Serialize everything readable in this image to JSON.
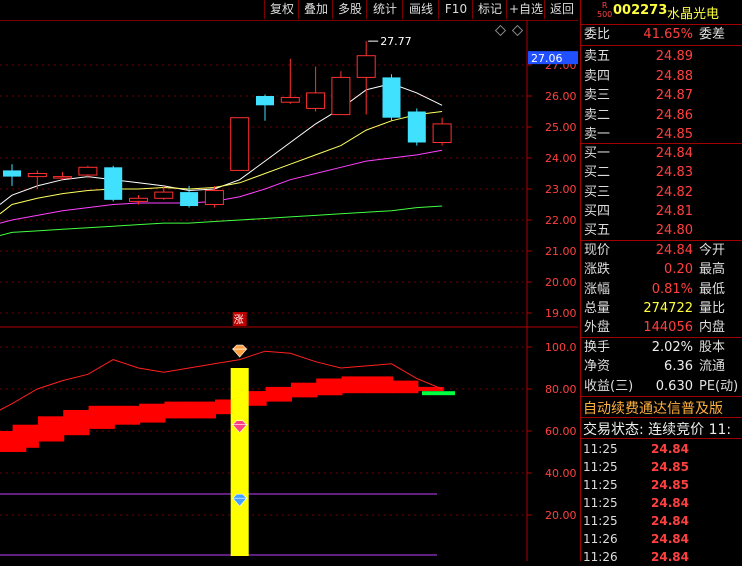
{
  "toolbar": {
    "buttons": [
      "复权",
      "叠加",
      "多股",
      "统计",
      "画线",
      "F10",
      "标记",
      "+自选",
      "返回"
    ]
  },
  "stock": {
    "market_badge_top": "R",
    "market_badge_bottom": "500",
    "code": "002273",
    "name": "水晶光电"
  },
  "order_ratio": {
    "label": "委比",
    "value": "41.65%",
    "right_label": "委差"
  },
  "sells": [
    {
      "label": "卖五",
      "price": "24.89"
    },
    {
      "label": "卖四",
      "price": "24.88"
    },
    {
      "label": "卖三",
      "price": "24.87"
    },
    {
      "label": "卖二",
      "price": "24.86"
    },
    {
      "label": "卖一",
      "price": "24.85"
    }
  ],
  "buys": [
    {
      "label": "买一",
      "price": "24.84"
    },
    {
      "label": "买二",
      "price": "24.83"
    },
    {
      "label": "买三",
      "price": "24.82"
    },
    {
      "label": "买四",
      "price": "24.81"
    },
    {
      "label": "买五",
      "price": "24.80"
    }
  ],
  "quote": [
    {
      "label": "现价",
      "value": "24.84",
      "right": "今开"
    },
    {
      "label": "涨跌",
      "value": "0.20",
      "right": "最高"
    },
    {
      "label": "涨幅",
      "value": "0.81%",
      "right": "最低"
    },
    {
      "label": "总量",
      "value": "274722",
      "right": "量比"
    },
    {
      "label": "外盘",
      "value": "144056",
      "right": "内盘"
    }
  ],
  "stats": [
    {
      "label": "换手",
      "value": "2.02%",
      "right": "股本"
    },
    {
      "label": "净资",
      "value": "6.36",
      "right": "流通"
    },
    {
      "label": "收益(三)",
      "value": "0.630",
      "right": "PE(动)"
    }
  ],
  "banner": "自动续费通达信普及版",
  "trade_status": "交易状态: 连续竞价 11:",
  "ticks": [
    {
      "time": "11:25",
      "price": "24.84"
    },
    {
      "time": "11:25",
      "price": "24.85"
    },
    {
      "time": "11:25",
      "price": "24.85"
    },
    {
      "time": "11:25",
      "price": "24.84"
    },
    {
      "time": "11:25",
      "price": "24.84"
    },
    {
      "time": "11:26",
      "price": "24.84"
    },
    {
      "time": "11:26",
      "price": "24.84"
    }
  ],
  "chart_data": [
    {
      "type": "candlestick",
      "title": "",
      "y_ticks": [
        "27.00",
        "26.00",
        "25.00",
        "24.00",
        "23.00",
        "22.00",
        "21.00",
        "20.00",
        "19.00"
      ],
      "ylim": [
        18.7,
        27.9
      ],
      "current_price_label": "27.06",
      "high_annotation": "27.77",
      "limit_up_marker": "涨",
      "candles": [
        {
          "o": 23.6,
          "c": 23.4,
          "h": 23.8,
          "l": 23.1
        },
        {
          "o": 23.4,
          "c": 23.5,
          "h": 23.6,
          "l": 23.0
        },
        {
          "o": 23.4,
          "c": 23.4,
          "h": 23.55,
          "l": 23.3
        },
        {
          "o": 23.45,
          "c": 23.7,
          "h": 23.75,
          "l": 23.35
        },
        {
          "o": 23.7,
          "c": 22.65,
          "h": 23.75,
          "l": 22.6
        },
        {
          "o": 22.6,
          "c": 22.7,
          "h": 22.8,
          "l": 22.5
        },
        {
          "o": 22.7,
          "c": 22.9,
          "h": 23.1,
          "l": 22.65
        },
        {
          "o": 22.9,
          "c": 22.45,
          "h": 23.1,
          "l": 22.4
        },
        {
          "o": 22.5,
          "c": 22.95,
          "h": 23.1,
          "l": 22.4
        },
        {
          "o": 23.6,
          "c": 25.3,
          "h": 25.3,
          "l": 23.6
        },
        {
          "o": 26.0,
          "c": 25.7,
          "h": 26.05,
          "l": 25.2
        },
        {
          "o": 25.8,
          "c": 25.95,
          "h": 27.2,
          "l": 25.75
        },
        {
          "o": 25.6,
          "c": 26.1,
          "h": 26.95,
          "l": 25.5
        },
        {
          "o": 25.4,
          "c": 26.6,
          "h": 26.8,
          "l": 25.4
        },
        {
          "o": 26.6,
          "c": 27.3,
          "h": 27.77,
          "l": 25.4
        },
        {
          "o": 26.6,
          "c": 25.3,
          "h": 26.7,
          "l": 25.2
        },
        {
          "o": 25.5,
          "c": 24.5,
          "h": 25.6,
          "l": 24.4
        },
        {
          "o": 24.5,
          "c": 25.1,
          "h": 25.3,
          "l": 24.4
        }
      ],
      "ma_series": [
        {
          "color": "#ffffff",
          "values": [
            22.8,
            23.1,
            23.3,
            23.4,
            23.3,
            23.2,
            23.1,
            22.95,
            23.0,
            23.3,
            23.9,
            24.5,
            25.1,
            25.6,
            26.2,
            26.4,
            26.1,
            25.7
          ]
        },
        {
          "color": "#ffff60",
          "values": [
            22.5,
            22.7,
            22.85,
            22.95,
            23.0,
            23.0,
            23.05,
            23.0,
            23.05,
            23.2,
            23.5,
            23.8,
            24.1,
            24.4,
            24.9,
            25.2,
            25.4,
            25.5
          ]
        },
        {
          "color": "#ff40ff",
          "values": [
            22.0,
            22.15,
            22.3,
            22.4,
            22.5,
            22.55,
            22.55,
            22.55,
            22.6,
            22.75,
            23.0,
            23.3,
            23.5,
            23.7,
            23.9,
            24.0,
            24.1,
            24.25
          ]
        },
        {
          "color": "#40ff40",
          "values": [
            21.6,
            21.65,
            21.7,
            21.75,
            21.8,
            21.85,
            21.9,
            21.9,
            21.95,
            22.0,
            22.05,
            22.1,
            22.15,
            22.2,
            22.25,
            22.3,
            22.4,
            22.45
          ]
        }
      ]
    },
    {
      "type": "area",
      "title": "",
      "y_ticks": [
        "100.0",
        "80.00",
        "60.00",
        "40.00",
        "20.00"
      ],
      "ylim": [
        0,
        105
      ],
      "band_top": [
        60,
        63,
        67,
        70,
        72,
        72,
        73,
        74,
        74,
        75,
        79,
        81,
        83,
        85,
        86,
        86,
        84,
        81
      ],
      "band_bottom": [
        50,
        52,
        55,
        58,
        61,
        63,
        64,
        66,
        66,
        68,
        72,
        74,
        76,
        77,
        78,
        78,
        78,
        79
      ],
      "line": [
        73,
        80,
        84,
        87,
        94,
        90,
        88,
        90,
        92,
        94,
        98,
        97,
        93,
        90,
        91,
        92,
        85,
        80
      ],
      "signal_bar_value": 90
    }
  ]
}
